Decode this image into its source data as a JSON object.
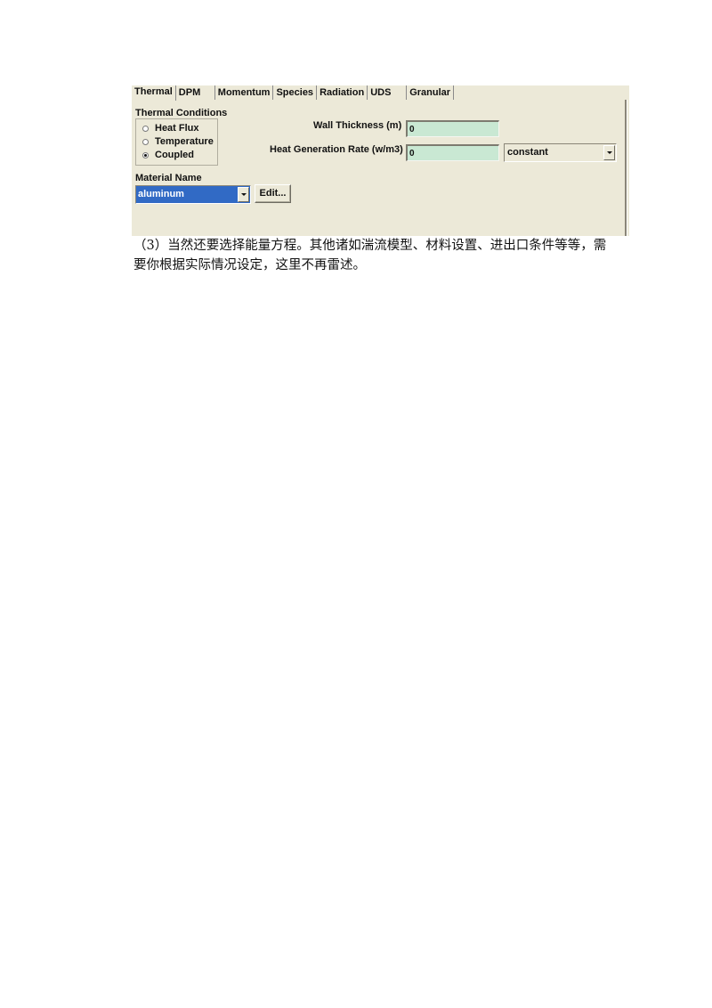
{
  "panel": {
    "tabs": [
      {
        "label": "Thermal",
        "active": true
      },
      {
        "label": "DPM",
        "active": false
      },
      {
        "label": "Momentum",
        "active": false
      },
      {
        "label": "Species",
        "active": false
      },
      {
        "label": "Radiation",
        "active": false
      },
      {
        "label": "UDS",
        "active": false
      },
      {
        "label": "Granular",
        "active": false
      }
    ],
    "thermal_conditions": {
      "title": "Thermal Conditions",
      "options": [
        {
          "label": "Heat Flux",
          "checked": false
        },
        {
          "label": "Temperature",
          "checked": false
        },
        {
          "label": "Coupled",
          "checked": true
        }
      ]
    },
    "wall_thickness": {
      "label": "Wall Thickness (m)",
      "value": "0"
    },
    "heat_generation": {
      "label": "Heat Generation Rate (w/m3)",
      "value": "0",
      "method": "constant"
    },
    "material": {
      "label": "Material Name",
      "value": "aluminum",
      "edit_label": "Edit..."
    }
  },
  "paragraph": "（3）当然还要选择能量方程。其他诸如湍流模型、材料设置、进出口条件等等，需要你根据实际情况设定，这里不再雷述。",
  "colors": {
    "panel_bg": "#ece9d8",
    "field_bg": "#c9e8d3",
    "selection_bg": "#316ac5"
  }
}
